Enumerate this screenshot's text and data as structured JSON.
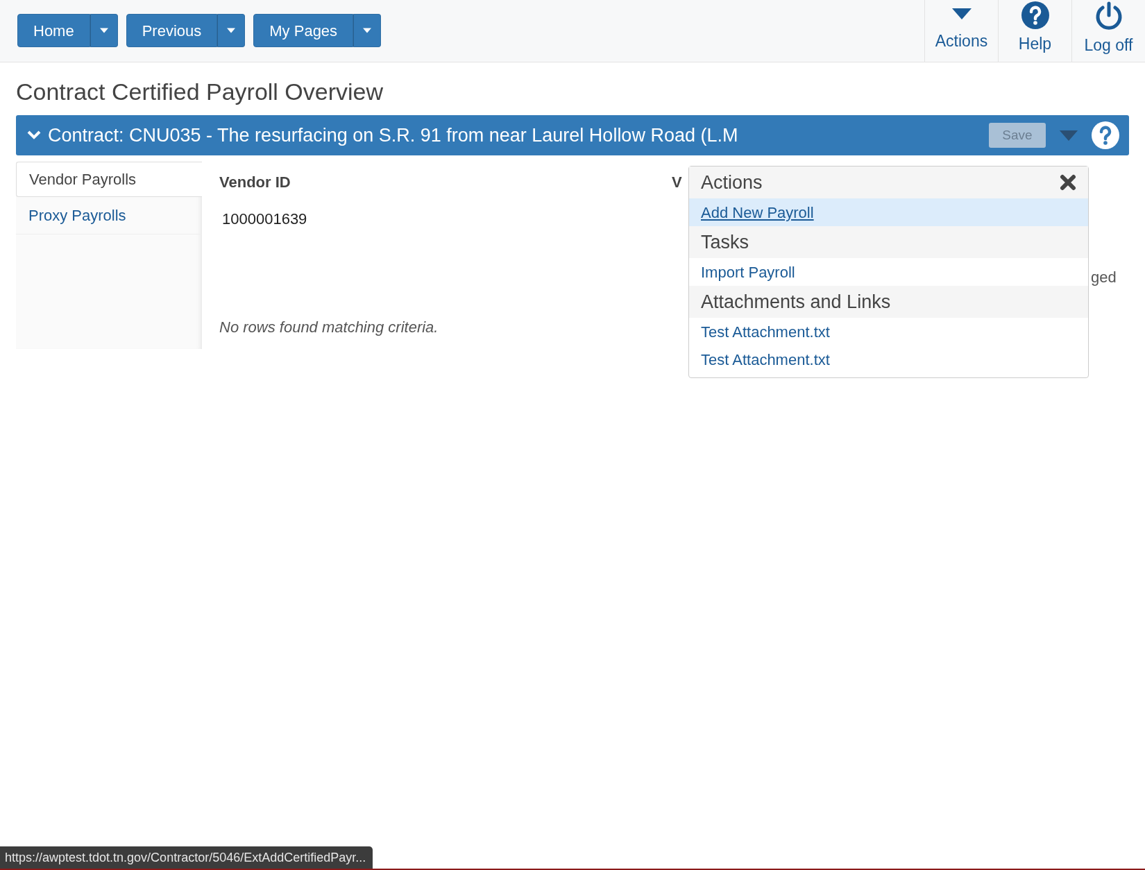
{
  "nav": {
    "buttons": [
      {
        "label": "Home"
      },
      {
        "label": "Previous"
      },
      {
        "label": "My Pages"
      }
    ],
    "right_items": [
      {
        "kind": "caret",
        "label": "Actions"
      },
      {
        "kind": "help",
        "label": "Help"
      },
      {
        "kind": "power",
        "label": "Log off"
      }
    ]
  },
  "page_title": "Contract Certified Payroll Overview",
  "contract_bar": {
    "title": "Contract: CNU035 - The resurfacing on S.R. 91 from near Laurel Hollow Road (L.M",
    "save_button": {
      "label": "Save",
      "disabled": true
    }
  },
  "sidebar": {
    "items": [
      {
        "label": "Vendor Payrolls",
        "selected": true
      },
      {
        "label": "Proxy Payrolls",
        "selected": false
      }
    ]
  },
  "table": {
    "columns": [
      {
        "label": "Vendor ID"
      },
      {
        "label": "V"
      }
    ],
    "rows": [
      {
        "cells": [
          "1000001639"
        ]
      }
    ],
    "empty_message": "No rows found matching criteria.",
    "column_2_fragment": "ged"
  },
  "actions_popup": {
    "sections": [
      {
        "heading": "Actions",
        "closable": true,
        "items": [
          {
            "label": "Add New Payroll",
            "selected": true
          }
        ]
      },
      {
        "heading": "Tasks",
        "closable": false,
        "items": [
          {
            "label": "Import Payroll",
            "selected": false
          }
        ]
      },
      {
        "heading": "Attachments and Links",
        "closable": false,
        "items": [
          {
            "label": "Test Attachment.txt",
            "selected": false
          },
          {
            "label": "Test Attachment.txt",
            "selected": false
          }
        ]
      }
    ]
  },
  "status_url": "https://awptest.tdot.tn.gov/Contractor/5046/ExtAddCertifiedPayr..."
}
